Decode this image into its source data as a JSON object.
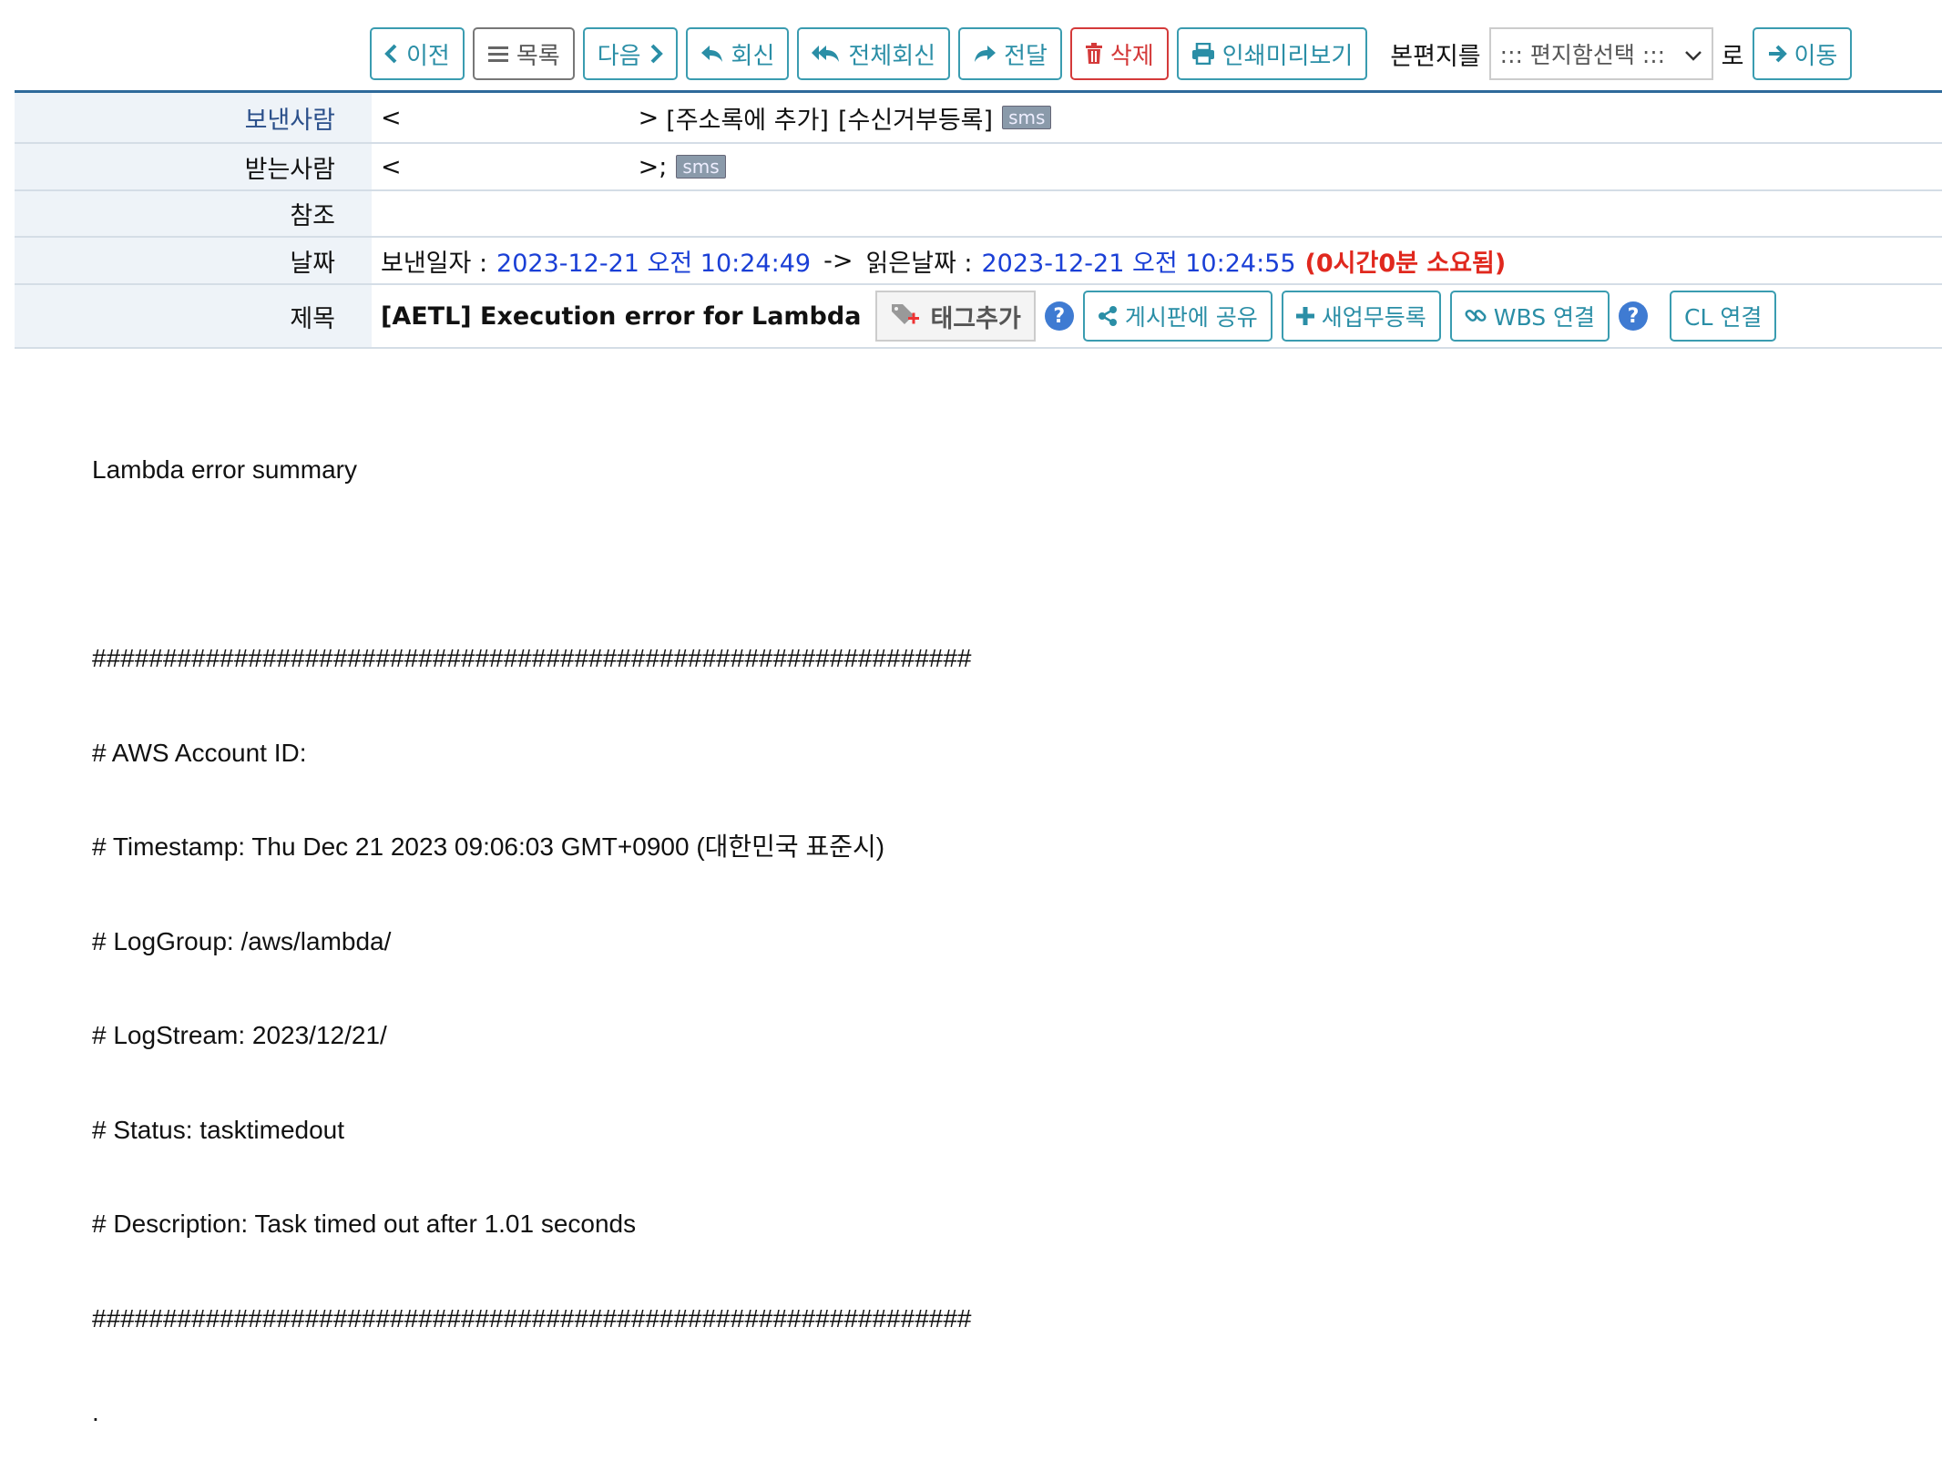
{
  "toolbar": {
    "prev": "이전",
    "list": "목록",
    "next": "다음",
    "reply": "회신",
    "reply_all": "전체회신",
    "forward": "전달",
    "delete": "삭제",
    "print_preview": "인쇄미리보기",
    "move_prefix": "본편지를",
    "folder_select": "::: 편지함선택 :::",
    "move_suffix": "로",
    "move": "이동"
  },
  "header": {
    "from_label": "보낸사람",
    "from_open": "<",
    "from_close": ">",
    "add_contact": "[주소록에 추가]",
    "block": "[수신거부등록]",
    "sms": "sms",
    "to_label": "받는사람",
    "to_open": "<",
    "to_close": ">;",
    "cc_label": "참조",
    "date_label": "날짜",
    "sent_prefix": "보낸일자 :",
    "sent_date": "2023-12-21 오전 10:24:49",
    "arrow": "->",
    "read_prefix": "읽은날짜 :",
    "read_date": "2023-12-21 오전 10:24:55",
    "elapsed": "(0시간0분 소요됨)",
    "subject_label": "제목",
    "subject": "[AETL] Execution error for Lambda",
    "add_tag": "태그추가",
    "share_board": "게시판에 공유",
    "new_task": "새업무등록",
    "wbs_link": "WBS 연결",
    "cl_link": "CL 연결"
  },
  "body": {
    "lines": [
      "Lambda error summary",
      "",
      "##############################################################",
      "# AWS Account ID:",
      "# Timestamp: Thu Dec 21 2023 09:06:03 GMT+0900 (대한민국 표준시)",
      "# LogGroup: /aws/lambda/",
      "# LogStream: 2023/12/21/",
      "# Status: tasktimedout",
      "# Description: Task timed out after 1.01 seconds",
      "##############################################################",
      "."
    ]
  },
  "colors": {
    "accent": "#2a8ea6",
    "delete": "#d43a3a",
    "date_blue": "#1a3fd6",
    "elapsed_red": "#e0281e",
    "label_bg": "#eef3f8"
  }
}
